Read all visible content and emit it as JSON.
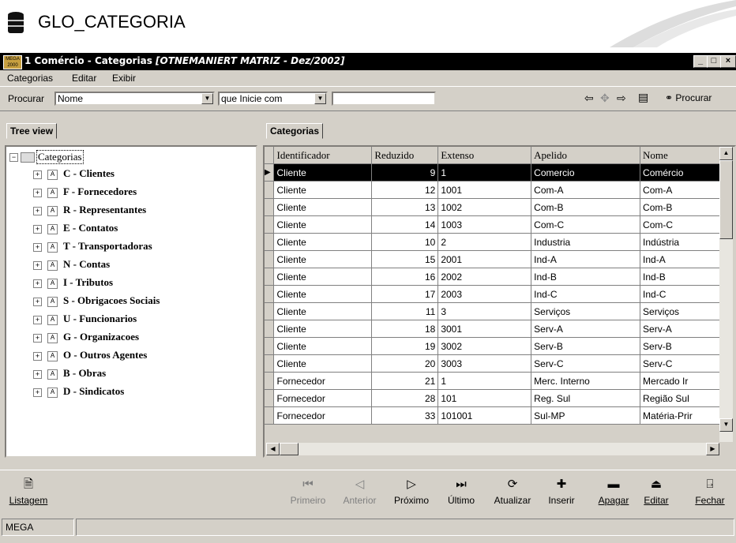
{
  "header": {
    "title": "GLO_CATEGORIA",
    "icon": "database-icon"
  },
  "window": {
    "icon_text": "MEGA 2000",
    "title_prefix": "1 Comércio - Categorias ",
    "title_context": "[OTNEMANIERT MATRIZ - Dez/2002]",
    "buttons": [
      "_",
      "□",
      "×"
    ]
  },
  "menu": [
    "Categorias",
    "Editar",
    "Exibir"
  ],
  "search": {
    "label": "Procurar",
    "field_value": "Nome",
    "mode_value": "que Inicie com",
    "text_value": "",
    "search_button": "Procurar"
  },
  "tree": {
    "tab_label": "Tree view",
    "root": "Categorias",
    "items": [
      "C - Clientes",
      "F - Fornecedores",
      "R - Representantes",
      "E - Contatos",
      "T - Transportadoras",
      "N - Contas",
      "I - Tributos",
      "S - Obrigacoes Sociais",
      "U - Funcionarios",
      "G - Organizacoes",
      "O - Outros Agentes",
      "B - Obras",
      "D - Sindicatos"
    ]
  },
  "grid": {
    "tab_label": "Categorias",
    "columns": [
      "Identificador",
      "Reduzido",
      "Extenso",
      "Apelido",
      "Nome"
    ],
    "rows": [
      [
        "Cliente",
        "9",
        "1",
        "Comercio",
        "Comércio"
      ],
      [
        "Cliente",
        "12",
        "1001",
        "Com-A",
        "Com-A"
      ],
      [
        "Cliente",
        "13",
        "1002",
        "Com-B",
        "Com-B"
      ],
      [
        "Cliente",
        "14",
        "1003",
        "Com-C",
        "Com-C"
      ],
      [
        "Cliente",
        "10",
        "2",
        "Industria",
        "Indústria"
      ],
      [
        "Cliente",
        "15",
        "2001",
        "Ind-A",
        "Ind-A"
      ],
      [
        "Cliente",
        "16",
        "2002",
        "Ind-B",
        "Ind-B"
      ],
      [
        "Cliente",
        "17",
        "2003",
        "Ind-C",
        "Ind-C"
      ],
      [
        "Cliente",
        "11",
        "3",
        "Serviços",
        "Serviços"
      ],
      [
        "Cliente",
        "18",
        "3001",
        "Serv-A",
        "Serv-A"
      ],
      [
        "Cliente",
        "19",
        "3002",
        "Serv-B",
        "Serv-B"
      ],
      [
        "Cliente",
        "20",
        "3003",
        "Serv-C",
        "Serv-C"
      ],
      [
        "Fornecedor",
        "21",
        "1",
        "Merc. Interno",
        "Mercado Ir"
      ],
      [
        "Fornecedor",
        "28",
        "101",
        "Reg. Sul",
        "Região Sul"
      ],
      [
        "Fornecedor",
        "33",
        "101001",
        "Sul-MP",
        "Matéria-Prir"
      ]
    ],
    "selected_row": 0
  },
  "actions": {
    "listagem": "Listagem",
    "primeiro": "Primeiro",
    "anterior": "Anterior",
    "proximo": "Próximo",
    "ultimo": "Último",
    "atualizar": "Atualizar",
    "inserir": "Inserir",
    "apagar": "Apagar",
    "editar": "Editar",
    "fechar": "Fechar"
  },
  "status": {
    "left": "MEGA",
    "right": ""
  }
}
